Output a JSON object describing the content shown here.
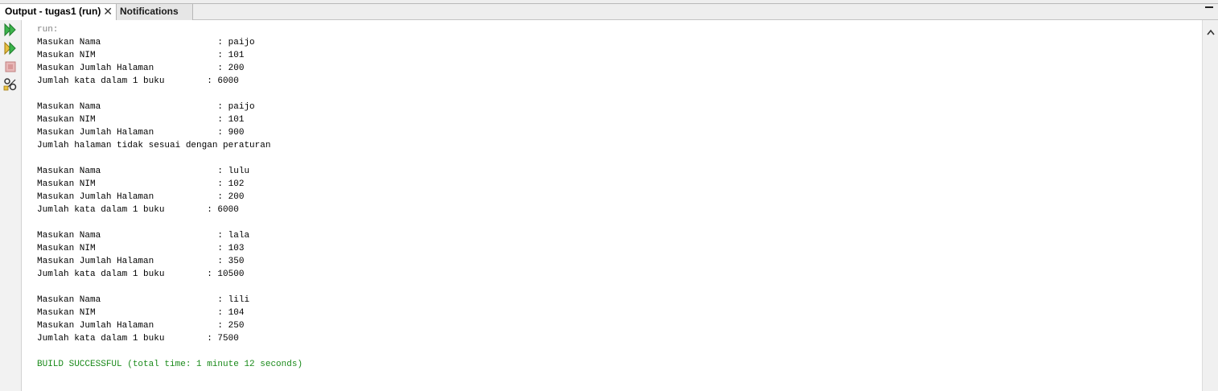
{
  "tabs": [
    {
      "label": "Output - tugas1 (run)",
      "active": true
    },
    {
      "label": "Notifications",
      "active": false
    }
  ],
  "toolbar_icons": [
    "rerun-icon",
    "rerun-with-options-icon",
    "stop-icon",
    "settings-icon"
  ],
  "output": {
    "run_label": "run:",
    "blocks": [
      {
        "lines": [
          "Masukan Nama                      : paijo",
          "Masukan NIM                       : 101",
          "Masukan Jumlah Halaman            : 200",
          "Jumlah kata dalam 1 buku        : 6000"
        ]
      },
      {
        "lines": [
          "Masukan Nama                      : paijo",
          "Masukan NIM                       : 101",
          "Masukan Jumlah Halaman            : 900",
          "Jumlah halaman tidak sesuai dengan peraturan"
        ]
      },
      {
        "lines": [
          "Masukan Nama                      : lulu",
          "Masukan NIM                       : 102",
          "Masukan Jumlah Halaman            : 200",
          "Jumlah kata dalam 1 buku        : 6000"
        ]
      },
      {
        "lines": [
          "Masukan Nama                      : lala",
          "Masukan NIM                       : 103",
          "Masukan Jumlah Halaman            : 350",
          "Jumlah kata dalam 1 buku        : 10500"
        ]
      },
      {
        "lines": [
          "Masukan Nama                      : lili",
          "Masukan NIM                       : 104",
          "Masukan Jumlah Halaman            : 250",
          "Jumlah kata dalam 1 buku        : 7500"
        ]
      }
    ],
    "build_status": "BUILD SUCCESSFUL (total time: 1 minute 12 seconds)"
  },
  "colors": {
    "success": "#1a8a1a",
    "run": "#808080",
    "icon_green": "#3cb44b"
  }
}
